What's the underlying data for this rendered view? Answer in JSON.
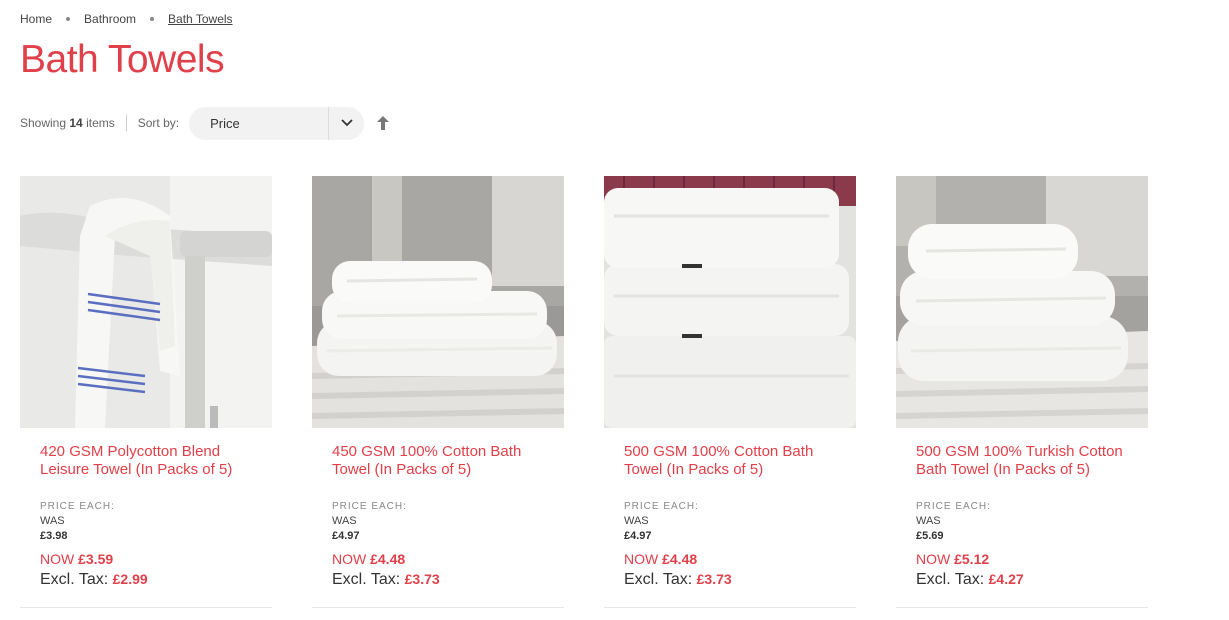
{
  "breadcrumb": [
    {
      "label": "Home"
    },
    {
      "label": "Bathroom"
    },
    {
      "label": "Bath Towels"
    }
  ],
  "page_title": "Bath Towels",
  "toolbar": {
    "showing_prefix": "Showing",
    "showing_count": "14",
    "showing_suffix": "items",
    "sort_label": "Sort by:",
    "sort_value": "Price"
  },
  "products": [
    {
      "name": "420 GSM Polycotton Blend Leisure Towel (In Packs of 5)",
      "price_each_label": "PRICE EACH:",
      "was_label": "WAS",
      "was_price": "£3.98",
      "now_label": "NOW",
      "now_price": "£3.59",
      "excl_label": "Excl. Tax:",
      "excl_price": "£2.99"
    },
    {
      "name": "450 GSM 100% Cotton Bath Towel (In Packs of 5)",
      "price_each_label": "PRICE EACH:",
      "was_label": "WAS",
      "was_price": "£4.97",
      "now_label": "NOW",
      "now_price": "£4.48",
      "excl_label": "Excl. Tax:",
      "excl_price": "£3.73"
    },
    {
      "name": "500 GSM 100% Cotton Bath Towel (In Packs of 5)",
      "price_each_label": "PRICE EACH:",
      "was_label": "WAS",
      "was_price": "£4.97",
      "now_label": "NOW",
      "now_price": "£4.48",
      "excl_label": "Excl. Tax:",
      "excl_price": "£3.73"
    },
    {
      "name": "500 GSM 100% Turkish Cotton Bath Towel (In Packs of 5)",
      "price_each_label": "PRICE EACH:",
      "was_label": "WAS",
      "was_price": "£5.69",
      "now_label": "NOW",
      "now_price": "£5.12",
      "excl_label": "Excl. Tax:",
      "excl_price": "£4.27"
    }
  ],
  "colors": {
    "accent": "#e0404a",
    "text": "#333333",
    "muted": "#888888"
  }
}
